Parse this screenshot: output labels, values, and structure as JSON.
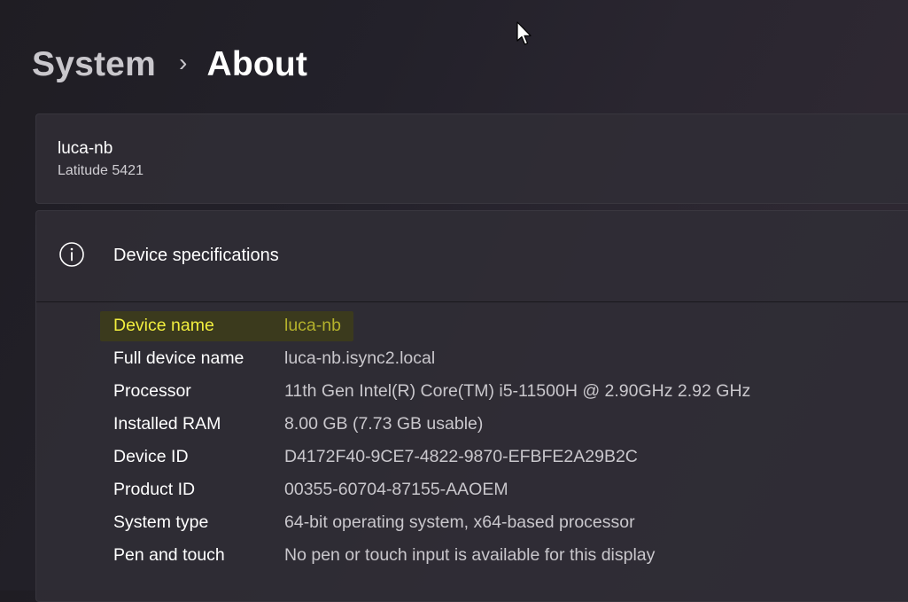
{
  "breadcrumb": {
    "parent": "System",
    "separator": "›",
    "current": "About"
  },
  "device_card": {
    "name": "luca-nb",
    "model": "Latitude 5421"
  },
  "specifications": {
    "icon": "info-icon",
    "title": "Device specifications",
    "rows": [
      {
        "label": "Device name",
        "value": "luca-nb",
        "highlighted": true
      },
      {
        "label": "Full device name",
        "value": "luca-nb.isync2.local"
      },
      {
        "label": "Processor",
        "value": "11th Gen Intel(R) Core(TM) i5-11500H @ 2.90GHz   2.92 GHz"
      },
      {
        "label": "Installed RAM",
        "value": "8.00 GB (7.73 GB usable)"
      },
      {
        "label": "Device ID",
        "value": "D4172F40-9CE7-4822-9870-EFBFE2A29B2C"
      },
      {
        "label": "Product ID",
        "value": "00355-60704-87155-AAOEM"
      },
      {
        "label": "System type",
        "value": "64-bit operating system, x64-based processor"
      },
      {
        "label": "Pen and touch",
        "value": "No pen or touch input is available for this display"
      }
    ]
  },
  "colors": {
    "highlight_label": "#f1ee3e",
    "highlight_value": "#b4b22c",
    "highlight_background": "#3b3a1d"
  }
}
